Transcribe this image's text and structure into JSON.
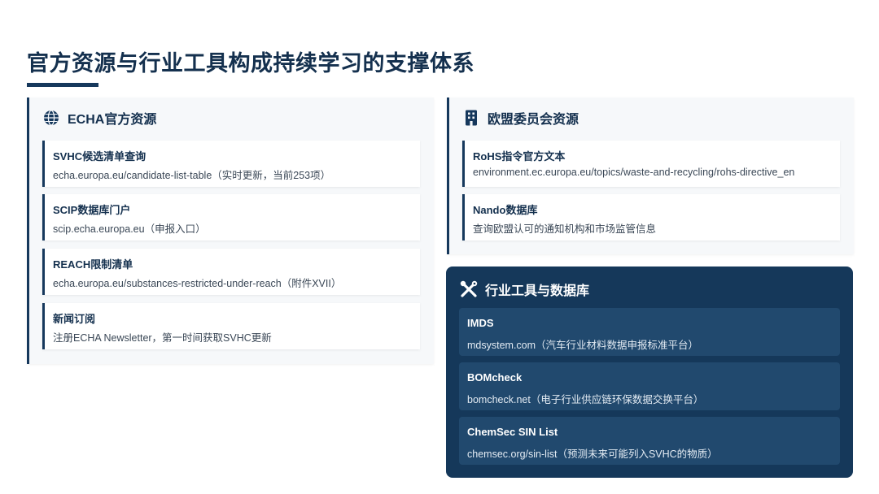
{
  "page": {
    "title": "官方资源与行业工具构成持续学习的支撑体系"
  },
  "echa": {
    "icon": "globe-icon",
    "title": "ECHA官方资源",
    "items": [
      {
        "title": "SVHC候选清单查询",
        "desc": "echa.europa.eu/candidate-list-table（实时更新，当前253项）"
      },
      {
        "title": "SCIP数据库门户",
        "desc": "scip.echa.europa.eu（申报入口）"
      },
      {
        "title": "REACH限制清单",
        "desc": "echa.europa.eu/substances-restricted-under-reach（附件XVII）"
      },
      {
        "title": "新闻订阅",
        "desc": "注册ECHA Newsletter，第一时间获取SVHC更新"
      }
    ]
  },
  "eu": {
    "icon": "building-icon",
    "title": "欧盟委员会资源",
    "items": [
      {
        "title": "RoHS指令官方文本",
        "desc": "environment.ec.europa.eu/topics/waste-and-recycling/rohs-directive_en"
      },
      {
        "title": "Nando数据库",
        "desc": "查询欧盟认可的通知机构和市场监管信息"
      }
    ]
  },
  "tools": {
    "icon": "tools-icon",
    "title": "行业工具与数据库",
    "items": [
      {
        "title": "IMDS",
        "desc": "mdsystem.com（汽车行业材料数据申报标准平台）"
      },
      {
        "title": "BOMcheck",
        "desc": "bomcheck.net（电子行业供应链环保数据交换平台）"
      },
      {
        "title": "ChemSec SIN List",
        "desc": "chemsec.org/sin-list（预测未来可能列入SVHC的物质）"
      }
    ]
  },
  "colors": {
    "navy": "#16385c",
    "dark_panel": "#15385a",
    "dark_item": "#21496e",
    "card_bg": "#f6f8fa"
  }
}
